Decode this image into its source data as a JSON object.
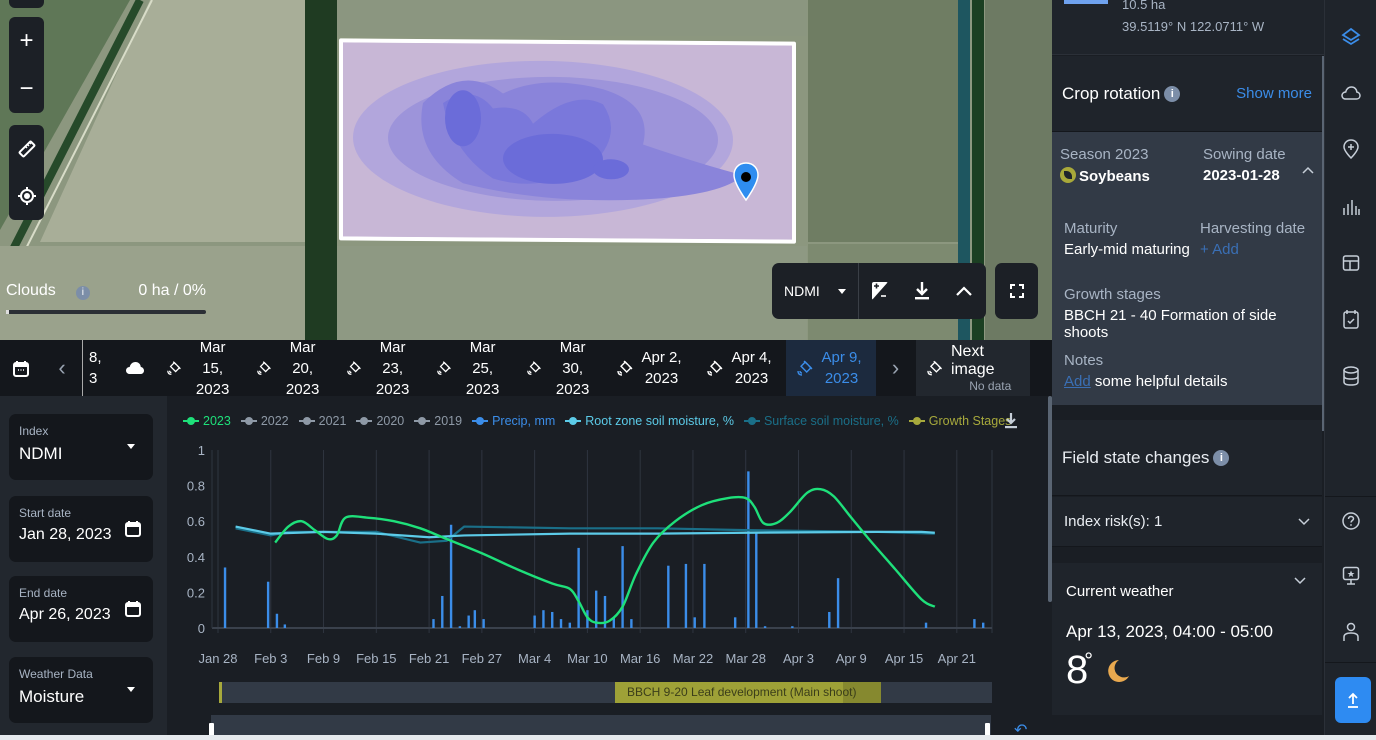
{
  "map": {
    "zoom_in": "+",
    "zoom_out": "−",
    "clouds": {
      "label": "Clouds",
      "value": "0 ha / 0%",
      "fraction": 0.0
    },
    "toolbar": {
      "index_label": "NDMI"
    }
  },
  "datestrip": {
    "partial_date_line1": "8,",
    "partial_date_line2": "3",
    "dates": [
      {
        "line1": "Mar 15,",
        "line2": "2023"
      },
      {
        "line1": "Mar 20,",
        "line2": "2023"
      },
      {
        "line1": "Mar 23,",
        "line2": "2023"
      },
      {
        "line1": "Mar 25,",
        "line2": "2023"
      },
      {
        "line1": "Mar 30,",
        "line2": "2023"
      },
      {
        "line1": "Apr 2,",
        "line2": "2023"
      },
      {
        "line1": "Apr 4,",
        "line2": "2023"
      },
      {
        "line1": "Apr 9,",
        "line2": "2023",
        "active": true
      }
    ],
    "next_image": {
      "label": "Next image",
      "sub": "No data"
    }
  },
  "form": {
    "index": {
      "label": "Index",
      "value": "NDMI"
    },
    "start_date": {
      "label": "Start date",
      "value": "Jan 28, 2023"
    },
    "end_date": {
      "label": "End date",
      "value": "Apr 26, 2023"
    },
    "weather_data": {
      "label": "Weather Data",
      "value": "Moisture"
    }
  },
  "legend": [
    {
      "label": "2023",
      "color": "#1ee07a"
    },
    {
      "label": "2022",
      "color": "#8e99a6"
    },
    {
      "label": "2021",
      "color": "#8e99a6"
    },
    {
      "label": "2020",
      "color": "#8e99a6"
    },
    {
      "label": "2019",
      "color": "#8e99a6"
    },
    {
      "label": "Precip, mm",
      "color": "#3b8de9"
    },
    {
      "label": "Root zone soil moisture, %",
      "color": "#5ccbe8"
    },
    {
      "label": "Surface soil moisture, %",
      "color": "#1a6f88"
    },
    {
      "label": "Growth Stages",
      "color": "#a7a93c"
    }
  ],
  "chart_data": {
    "type": "line",
    "title": "",
    "xlabel": "",
    "ylabel": "",
    "ylim": [
      0,
      1
    ],
    "yticks": [
      "0",
      "0.2",
      "0.4",
      "0.6",
      "0.8",
      "1"
    ],
    "x_tick_labels": [
      "Jan 28",
      "Feb 3",
      "Feb 9",
      "Feb 15",
      "Feb 21",
      "Feb 27",
      "Mar 4",
      "Mar 10",
      "Mar 16",
      "Mar 22",
      "Mar 28",
      "Apr 3",
      "Apr 9",
      "Apr 15",
      "Apr 21"
    ],
    "x_range_days": [
      0,
      88
    ],
    "series": [
      {
        "name": "2023 NDMI",
        "color": "#1ee07a",
        "points": [
          [
            6.5,
            0.48
          ],
          [
            8,
            0.57
          ],
          [
            9.5,
            0.6
          ],
          [
            11,
            0.55
          ],
          [
            12.5,
            0.5
          ],
          [
            13.5,
            0.52
          ],
          [
            14.5,
            0.62
          ],
          [
            17,
            0.62
          ],
          [
            20,
            0.6
          ],
          [
            23,
            0.56
          ],
          [
            26,
            0.5
          ],
          [
            30,
            0.42
          ],
          [
            34,
            0.33
          ],
          [
            38,
            0.25
          ],
          [
            40,
            0.22
          ],
          [
            41,
            0.15
          ],
          [
            42,
            0.06
          ],
          [
            43,
            0.03
          ],
          [
            44.5,
            0.04
          ],
          [
            46,
            0.12
          ],
          [
            47.5,
            0.3
          ],
          [
            49.5,
            0.48
          ],
          [
            52,
            0.6
          ],
          [
            55,
            0.69
          ],
          [
            58,
            0.73
          ],
          [
            60,
            0.73
          ],
          [
            61,
            0.68
          ],
          [
            62,
            0.59
          ],
          [
            63.5,
            0.59
          ],
          [
            65,
            0.65
          ],
          [
            67,
            0.76
          ],
          [
            68.5,
            0.78
          ],
          [
            70,
            0.74
          ],
          [
            72,
            0.62
          ],
          [
            74,
            0.5
          ],
          [
            77,
            0.33
          ],
          [
            80,
            0.16
          ],
          [
            81.5,
            0.12
          ]
        ]
      },
      {
        "name": "Root zone soil moisture, %",
        "color": "#5ccbe8",
        "points": [
          [
            2,
            0.57
          ],
          [
            6,
            0.53
          ],
          [
            12,
            0.54
          ],
          [
            18,
            0.53
          ],
          [
            24,
            0.51
          ],
          [
            28,
            0.52
          ],
          [
            40,
            0.53
          ],
          [
            50,
            0.53
          ],
          [
            60,
            0.535
          ],
          [
            75,
            0.54
          ],
          [
            80,
            0.54
          ],
          [
            81.5,
            0.535
          ]
        ]
      },
      {
        "name": "Surface soil moisture, %",
        "color": "#1a6f88",
        "points": [
          [
            2,
            0.56
          ],
          [
            6,
            0.52
          ],
          [
            8,
            0.54
          ],
          [
            18,
            0.54
          ],
          [
            23,
            0.48
          ],
          [
            26,
            0.49
          ],
          [
            28,
            0.57
          ],
          [
            40,
            0.56
          ],
          [
            50,
            0.56
          ],
          [
            60,
            0.55
          ],
          [
            75,
            0.54
          ],
          [
            81.5,
            0.53
          ]
        ]
      },
      {
        "name": "Precip, mm",
        "type": "bar",
        "color": "#3b8de9",
        "points": [
          [
            0.8,
            0.34
          ],
          [
            5.7,
            0.26
          ],
          [
            6.7,
            0.08
          ],
          [
            7.6,
            0.02
          ],
          [
            24.5,
            0.05
          ],
          [
            25.5,
            0.18
          ],
          [
            26.5,
            0.58
          ],
          [
            27.5,
            0.01
          ],
          [
            28.5,
            0.07
          ],
          [
            29.2,
            0.1
          ],
          [
            30.2,
            0.05
          ],
          [
            36,
            0.07
          ],
          [
            37,
            0.1
          ],
          [
            38,
            0.09
          ],
          [
            39,
            0.05
          ],
          [
            40,
            0.03
          ],
          [
            41,
            0.45
          ],
          [
            42,
            0.1
          ],
          [
            43,
            0.21
          ],
          [
            44,
            0.18
          ],
          [
            45,
            0.06
          ],
          [
            46,
            0.46
          ],
          [
            47,
            0.05
          ],
          [
            51.2,
            0.35
          ],
          [
            53.2,
            0.36
          ],
          [
            54.2,
            0.06
          ],
          [
            55.3,
            0.36
          ],
          [
            58.8,
            0.06
          ],
          [
            60.3,
            0.88
          ],
          [
            61.2,
            0.54
          ],
          [
            62.2,
            0.01
          ],
          [
            65.3,
            0.01
          ],
          [
            69.5,
            0.09
          ],
          [
            70.5,
            0.28
          ],
          [
            80.5,
            0.03
          ],
          [
            86,
            0.05
          ],
          [
            87,
            0.03
          ]
        ]
      }
    ]
  },
  "growth_stage_bar": {
    "label": "BBCH 9-20 Leaf development (Main shoot)"
  },
  "right_panel": {
    "field_area": "10.5 ha",
    "coords": "39.5119° N 122.0711° W",
    "crop_rotation": {
      "title": "Crop rotation",
      "show_more": "Show more"
    },
    "season": {
      "label": "Season 2023",
      "crop": "Soybeans"
    },
    "sowing": {
      "label": "Sowing date",
      "value": "2023-01-28"
    },
    "maturity": {
      "label": "Maturity",
      "value": "Early-mid maturing"
    },
    "harvesting": {
      "label": "Harvesting date",
      "value": "+ Add"
    },
    "growth": {
      "label": "Growth stages",
      "value": "BBCH 21 - 40 Formation of side shoots"
    },
    "notes": {
      "label": "Notes",
      "link": "Add",
      "text": " some helpful details"
    },
    "field_state": {
      "title": "Field state changes"
    },
    "index_risk": "Index risk(s): 1",
    "weather": {
      "title": "Current weather",
      "datetime": "Apr 13, 2023, 04:00 - 05:00",
      "temp": "8",
      "unit": "°"
    }
  }
}
